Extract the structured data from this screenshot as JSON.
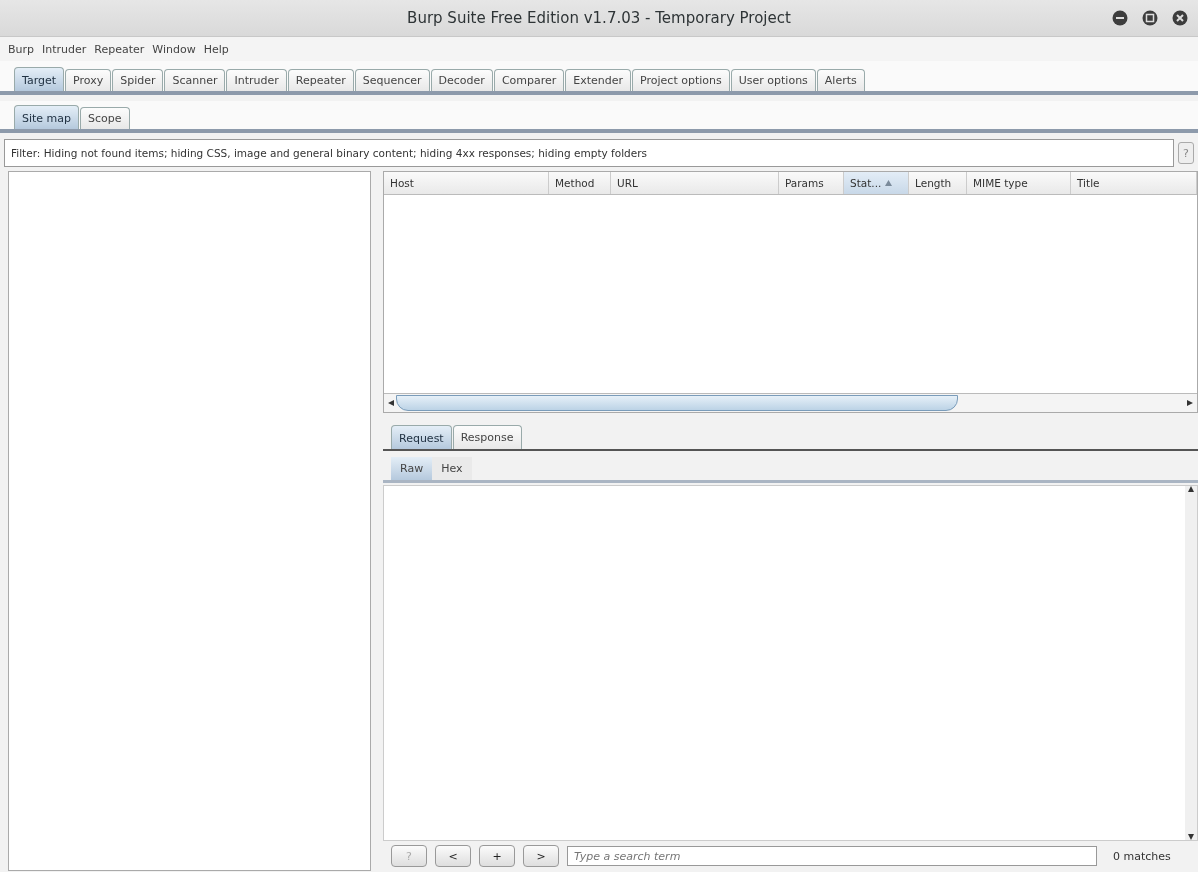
{
  "window": {
    "title": "Burp Suite Free Edition v1.7.03 - Temporary Project"
  },
  "menu": [
    "Burp",
    "Intruder",
    "Repeater",
    "Window",
    "Help"
  ],
  "tabs": [
    {
      "label": "Target",
      "selected": true
    },
    {
      "label": "Proxy",
      "selected": false
    },
    {
      "label": "Spider",
      "selected": false
    },
    {
      "label": "Scanner",
      "selected": false
    },
    {
      "label": "Intruder",
      "selected": false
    },
    {
      "label": "Repeater",
      "selected": false
    },
    {
      "label": "Sequencer",
      "selected": false
    },
    {
      "label": "Decoder",
      "selected": false
    },
    {
      "label": "Comparer",
      "selected": false
    },
    {
      "label": "Extender",
      "selected": false
    },
    {
      "label": "Project options",
      "selected": false
    },
    {
      "label": "User options",
      "selected": false
    },
    {
      "label": "Alerts",
      "selected": false
    }
  ],
  "subtabs": [
    {
      "label": "Site map",
      "selected": true
    },
    {
      "label": "Scope",
      "selected": false
    }
  ],
  "filter": {
    "text": "Filter:  Hiding not found items;  hiding CSS, image and general binary content;  hiding 4xx responses;  hiding empty folders",
    "help": "?"
  },
  "table": {
    "columns": [
      {
        "label": "Host",
        "sorted": false
      },
      {
        "label": "Method",
        "sorted": false
      },
      {
        "label": "URL",
        "sorted": false
      },
      {
        "label": "Params",
        "sorted": false
      },
      {
        "label": "Stat...",
        "sorted": true
      },
      {
        "label": "Length",
        "sorted": false
      },
      {
        "label": "MIME type",
        "sorted": false
      },
      {
        "label": "Title",
        "sorted": false
      }
    ]
  },
  "message_tabs": [
    {
      "label": "Request",
      "selected": true
    },
    {
      "label": "Response",
      "selected": false
    }
  ],
  "view_tabs": [
    {
      "label": "Raw",
      "selected": true
    },
    {
      "label": "Hex",
      "selected": false
    }
  ],
  "search_bar": {
    "buttons": [
      {
        "label": "?",
        "disabled": true
      },
      {
        "label": "<",
        "disabled": false
      },
      {
        "label": "+",
        "disabled": false
      },
      {
        "label": ">",
        "disabled": false
      }
    ],
    "placeholder": "Type a search term",
    "matches": "0 matches"
  }
}
